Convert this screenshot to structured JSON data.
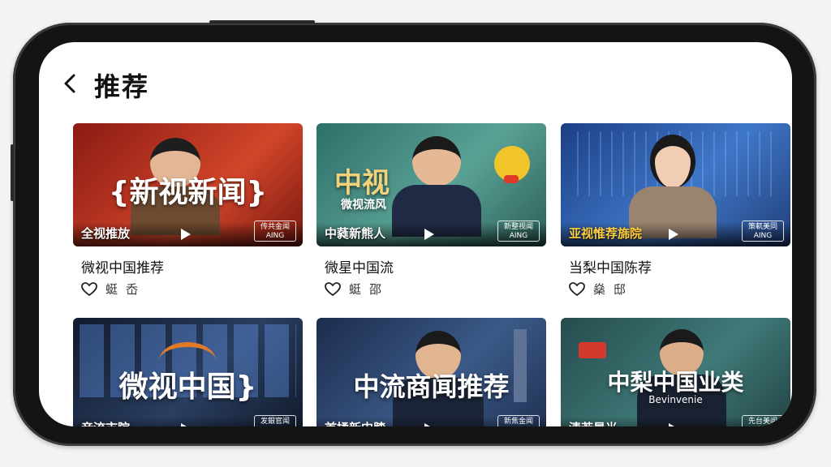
{
  "header": {
    "title": "推荐",
    "back_icon": "chevron-left-icon"
  },
  "cards": [
    {
      "big_text": "{新视新闻}",
      "strip_text": "全视推放",
      "logo_text": "传共金闻 AING",
      "title": "微视中国推荐",
      "meta_a": "蜓",
      "meta_b": "岙",
      "colors": [
        "#8b1a14",
        "#c8381f"
      ]
    },
    {
      "big_text": "中视",
      "sub_text": "微视流风",
      "strip_text": "中蕤新熊人",
      "logo_text": "新整视闻 AING",
      "title": "微星中国流",
      "meta_a": "蜓",
      "meta_b": "邵",
      "colors": [
        "#2d6f6a",
        "#4f9a8e"
      ]
    },
    {
      "big_text": "",
      "strip_text": "亚视惟荐旆院",
      "logo_text": "策軏美同 AING",
      "title": "当梨中国陈荐",
      "meta_a": "燊",
      "meta_b": "邸",
      "colors": [
        "#1c3f86",
        "#3f77c8"
      ]
    },
    {
      "big_text": "微视中国}",
      "strip_text": "音流市院",
      "logo_text": "发銀官闻 AING",
      "title": "",
      "meta_a": "",
      "meta_b": "",
      "colors": [
        "#101a2c",
        "#2a3e60"
      ]
    },
    {
      "big_text": "中流商闻推荐",
      "strip_text": "首揉新中膝",
      "logo_text": "新焦金闻 AING",
      "title": "",
      "meta_a": "",
      "meta_b": "",
      "colors": [
        "#1d2c4d",
        "#3b5a88"
      ]
    },
    {
      "big_text": "中梨中国业类",
      "sub_text": "Bevinvenie",
      "strip_text": "清若景光",
      "logo_text": "先台美闻 AING",
      "title": "",
      "meta_a": "",
      "meta_b": "",
      "colors": [
        "#264c4e",
        "#3f7a78"
      ]
    }
  ]
}
